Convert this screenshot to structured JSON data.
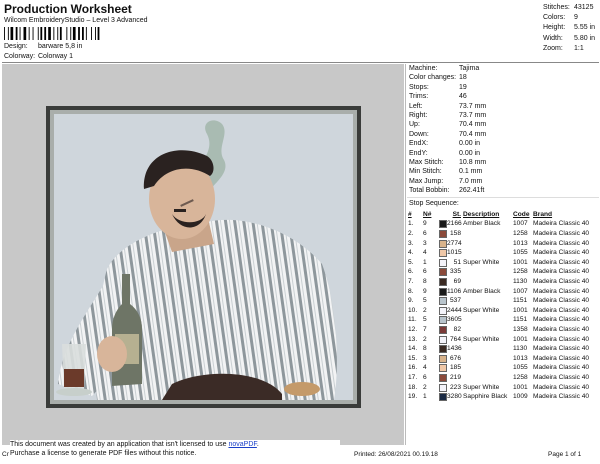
{
  "header": {
    "title": "Production Worksheet",
    "subtitle": "Wilcom EmbroideryStudio – Level 3 Advanced",
    "design_label": "Design:",
    "design_value": "barware 5,8 in",
    "colorway_label": "Colorway:",
    "colorway_value": "Colorway 1"
  },
  "stats": [
    {
      "label": "Stitches:",
      "value": "43125"
    },
    {
      "label": "Colors:",
      "value": "9"
    },
    {
      "label": "Height:",
      "value": "5.55 in"
    },
    {
      "label": "Width:",
      "value": "5.80 in"
    },
    {
      "label": "Zoom:",
      "value": "1:1"
    }
  ],
  "machine": [
    {
      "label": "Machine:",
      "value": "Tajima"
    },
    {
      "label": "Color changes:",
      "value": "18"
    },
    {
      "label": "Stops:",
      "value": "19"
    },
    {
      "label": "Trims:",
      "value": "46"
    },
    {
      "label": "Left:",
      "value": "73.7 mm"
    },
    {
      "label": "Right:",
      "value": "73.7 mm"
    },
    {
      "label": "Up:",
      "value": "70.4 mm"
    },
    {
      "label": "Down:",
      "value": "70.4 mm"
    },
    {
      "label": "EndX:",
      "value": "0.00 in"
    },
    {
      "label": "EndY:",
      "value": "0.00 in"
    },
    {
      "label": "Max Stitch:",
      "value": "10.8 mm"
    },
    {
      "label": "Min Stitch:",
      "value": "0.1 mm"
    },
    {
      "label": "Max Jump:",
      "value": "7.0 mm"
    },
    {
      "label": "Total Bobbin:",
      "value": "262.41ft"
    }
  ],
  "sequence": {
    "title": "Stop Sequence:",
    "columns": [
      "#",
      "N#",
      "St.",
      "Description",
      "Code",
      "Brand"
    ],
    "rows": [
      {
        "num": "1.",
        "n": "9",
        "color": "#1a1a1a",
        "st": "2166",
        "desc": "Amber Black",
        "code": "1007",
        "brand": "Madeira Classic 40"
      },
      {
        "num": "2.",
        "n": "6",
        "color": "#8b4a3a",
        "st": "158",
        "desc": "",
        "code": "1258",
        "brand": "Madeira Classic 40"
      },
      {
        "num": "3.",
        "n": "3",
        "color": "#d9b48c",
        "st": "2774",
        "desc": "",
        "code": "1013",
        "brand": "Madeira Classic 40"
      },
      {
        "num": "4.",
        "n": "4",
        "color": "#f0c8a8",
        "st": "1015",
        "desc": "",
        "code": "1055",
        "brand": "Madeira Classic 40"
      },
      {
        "num": "5.",
        "n": "1",
        "color": "#f4f4fa",
        "st": "51",
        "desc": "Super White",
        "code": "1001",
        "brand": "Madeira Classic 40"
      },
      {
        "num": "6.",
        "n": "6",
        "color": "#8b4a3a",
        "st": "335",
        "desc": "",
        "code": "1258",
        "brand": "Madeira Classic 40"
      },
      {
        "num": "7.",
        "n": "8",
        "color": "#3a2a22",
        "st": "69",
        "desc": "",
        "code": "1130",
        "brand": "Madeira Classic 40"
      },
      {
        "num": "8.",
        "n": "9",
        "color": "#1a1a1a",
        "st": "1106",
        "desc": "Amber Black",
        "code": "1007",
        "brand": "Madeira Classic 40"
      },
      {
        "num": "9.",
        "n": "5",
        "color": "#b8c4cc",
        "st": "537",
        "desc": "",
        "code": "1151",
        "brand": "Madeira Classic 40"
      },
      {
        "num": "10.",
        "n": "2",
        "color": "#f4f4fa",
        "st": "24442",
        "desc": "Super White",
        "code": "1001",
        "brand": "Madeira Classic 40"
      },
      {
        "num": "11.",
        "n": "5",
        "color": "#b8c4cc",
        "st": "3605",
        "desc": "",
        "code": "1151",
        "brand": "Madeira Classic 40"
      },
      {
        "num": "12.",
        "n": "7",
        "color": "#7a3a38",
        "st": "82",
        "desc": "",
        "code": "1358",
        "brand": "Madeira Classic 40"
      },
      {
        "num": "13.",
        "n": "2",
        "color": "#f4f4fa",
        "st": "764",
        "desc": "Super White",
        "code": "1001",
        "brand": "Madeira Classic 40"
      },
      {
        "num": "14.",
        "n": "8",
        "color": "#3a2a22",
        "st": "1436",
        "desc": "",
        "code": "1130",
        "brand": "Madeira Classic 40"
      },
      {
        "num": "15.",
        "n": "3",
        "color": "#d9b48c",
        "st": "676",
        "desc": "",
        "code": "1013",
        "brand": "Madeira Classic 40"
      },
      {
        "num": "16.",
        "n": "4",
        "color": "#f0c8a8",
        "st": "185",
        "desc": "",
        "code": "1055",
        "brand": "Madeira Classic 40"
      },
      {
        "num": "17.",
        "n": "6",
        "color": "#8b4a3a",
        "st": "219",
        "desc": "",
        "code": "1258",
        "brand": "Madeira Classic 40"
      },
      {
        "num": "18.",
        "n": "2",
        "color": "#f4f4fa",
        "st": "223",
        "desc": "Super White",
        "code": "1001",
        "brand": "Madeira Classic 40"
      },
      {
        "num": "19.",
        "n": "1",
        "color": "#1a2a44",
        "st": "3280",
        "desc": "Sapphire Black",
        "code": "1009",
        "brand": "Madeira Classic 40"
      }
    ]
  },
  "footer": {
    "notice_line1_pre": "This document was created by an application that isn't licensed to use ",
    "notice_link": "novaPDF",
    "notice_line1_post": ".",
    "notice_line2": "Purchase a license to generate PDF files without this notice.",
    "cr": "Cr",
    "printed": "Printed: 26/08/2021 00.19.18",
    "page": "Page 1 of 1"
  }
}
